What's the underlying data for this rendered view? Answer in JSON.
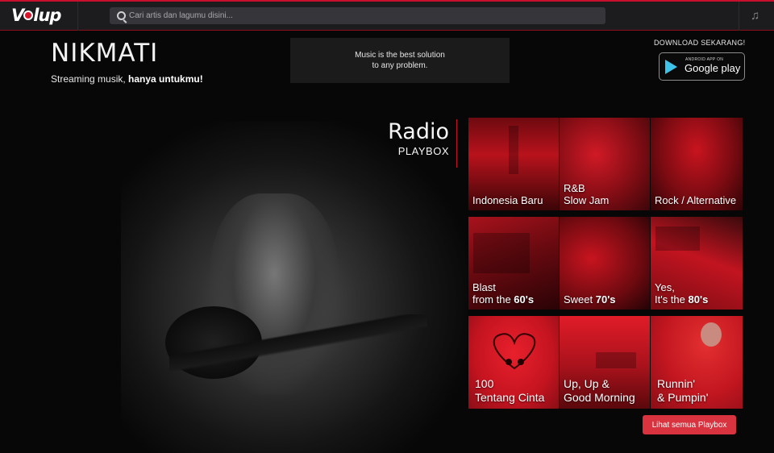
{
  "header": {
    "logo_text": "V",
    "logo_text_rest": "lup",
    "search_placeholder": "Cari artis dan lagumu disini...",
    "music_icon": "music-note-icon"
  },
  "brand": {
    "title": "NIKMATI",
    "tagline_normal": "Streaming musik, ",
    "tagline_bold": "hanya untukmu!"
  },
  "quote": {
    "line1": "Music is the best solution",
    "line2": "to any problem."
  },
  "download": {
    "label": "DOWNLOAD SEKARANG!",
    "badge_small": "ANDROID APP ON",
    "badge_big": "Google play"
  },
  "radio": {
    "title": "Radio",
    "subtitle": "PLAYBOX"
  },
  "playbox": [
    {
      "line1": "Indonesia Baru",
      "line2": "",
      "bold": ""
    },
    {
      "line1": "R&B",
      "line2": "Slow Jam",
      "bold": ""
    },
    {
      "line1": "Rock / Alternative",
      "line2": "",
      "bold": ""
    },
    {
      "line1": "Blast",
      "line2": "from the ",
      "bold": "60's"
    },
    {
      "line1": "",
      "line2": "Sweet ",
      "bold": "70's"
    },
    {
      "line1": "Yes,",
      "line2": "It's the ",
      "bold": "80's"
    },
    {
      "line1": "100",
      "line2": "Tentang Cinta",
      "bold": ""
    },
    {
      "line1": "Up, Up &",
      "line2": "Good Morning",
      "bold": ""
    },
    {
      "line1": "Runnin'",
      "line2": "& Pumpin'",
      "bold": ""
    }
  ],
  "see_all_label": "Lihat semua Playbox",
  "colors": {
    "accent": "#c8102e",
    "button": "#d8333f",
    "background": "#070707"
  }
}
